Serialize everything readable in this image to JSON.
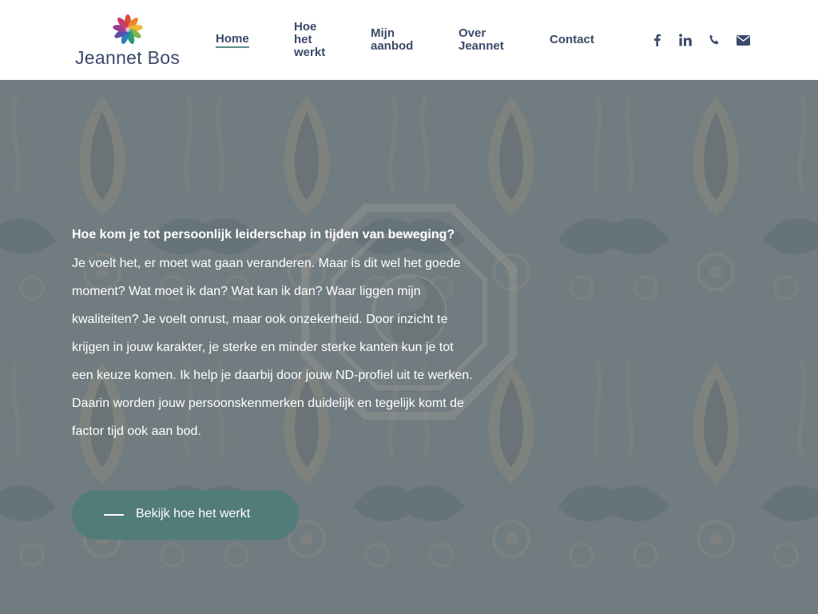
{
  "brand": {
    "name": "Jeannet Bos"
  },
  "nav": {
    "items": [
      {
        "label": "Home",
        "active": true
      },
      {
        "label": "Hoe het werkt",
        "lines": [
          "Hoe",
          "het",
          "werkt"
        ]
      },
      {
        "label": "Mijn aanbod",
        "lines": [
          "Mijn",
          "aanbod"
        ]
      },
      {
        "label": "Over Jeannet",
        "lines": [
          "Over",
          "Jeannet"
        ]
      },
      {
        "label": "Contact"
      }
    ]
  },
  "social": [
    "facebook-icon",
    "linkedin-icon",
    "phone-icon",
    "email-icon"
  ],
  "hero": {
    "subtitle": "Hoe kom je tot persoonlijk leiderschap in tijden van beweging?",
    "body_lines": [
      "Je voelt het, er moet wat gaan veranderen. Maar is dit wel het goede",
      "moment? Wat moet ik dan? Wat kan ik dan? Waar liggen mijn",
      "kwaliteiten? Je voelt onrust, maar ook onzekerheid. Door inzicht te",
      "krijgen in jouw karakter, je sterke en minder sterke kanten kun je tot",
      "een keuze komen. Ik help je daarbij door jouw ND-profiel uit te werken.",
      "Daarin worden jouw persoonskenmerken duidelijk en tegelijk komt de",
      "factor tijd ook aan bod."
    ],
    "cta_label": "Bekijk hoe het werkt"
  },
  "colors": {
    "accent": "#527c79",
    "nav_text": "#3b4a6b",
    "active_underline": "#5e8f8b"
  }
}
